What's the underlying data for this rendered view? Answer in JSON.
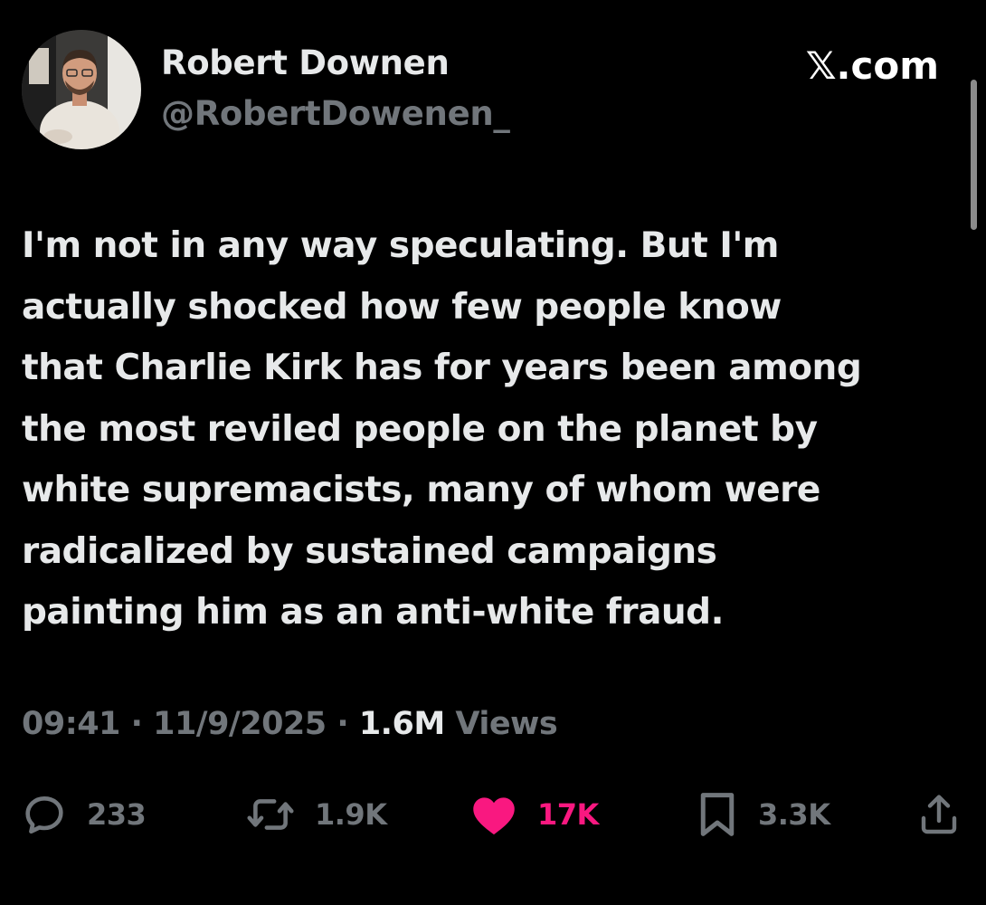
{
  "header": {
    "display_name": "Robert Downen",
    "handle": "@RobertDowenen_",
    "brand": "𝕏.com"
  },
  "tweet": {
    "lines": [
      "I'm not in any way speculating. But I'm",
      "actually shocked how few people know",
      "that Charlie Kirk has for years been among",
      "the most reviled people on the planet by",
      "white supremacists, many of whom were",
      "radicalized by sustained campaigns",
      "painting him as an anti-white fraud."
    ]
  },
  "meta": {
    "time": "09:41",
    "separator": "·",
    "date": "11/9/2025",
    "views_count": "1.6M",
    "views_label": "Views"
  },
  "actions": {
    "replies": "233",
    "reposts": "1.9K",
    "likes": "17K",
    "bookmarks": "3.3K"
  },
  "colors": {
    "background": "#000000",
    "primary_text": "#e7e9ea",
    "secondary_text": "#71767b",
    "like_accent": "#f91880"
  }
}
